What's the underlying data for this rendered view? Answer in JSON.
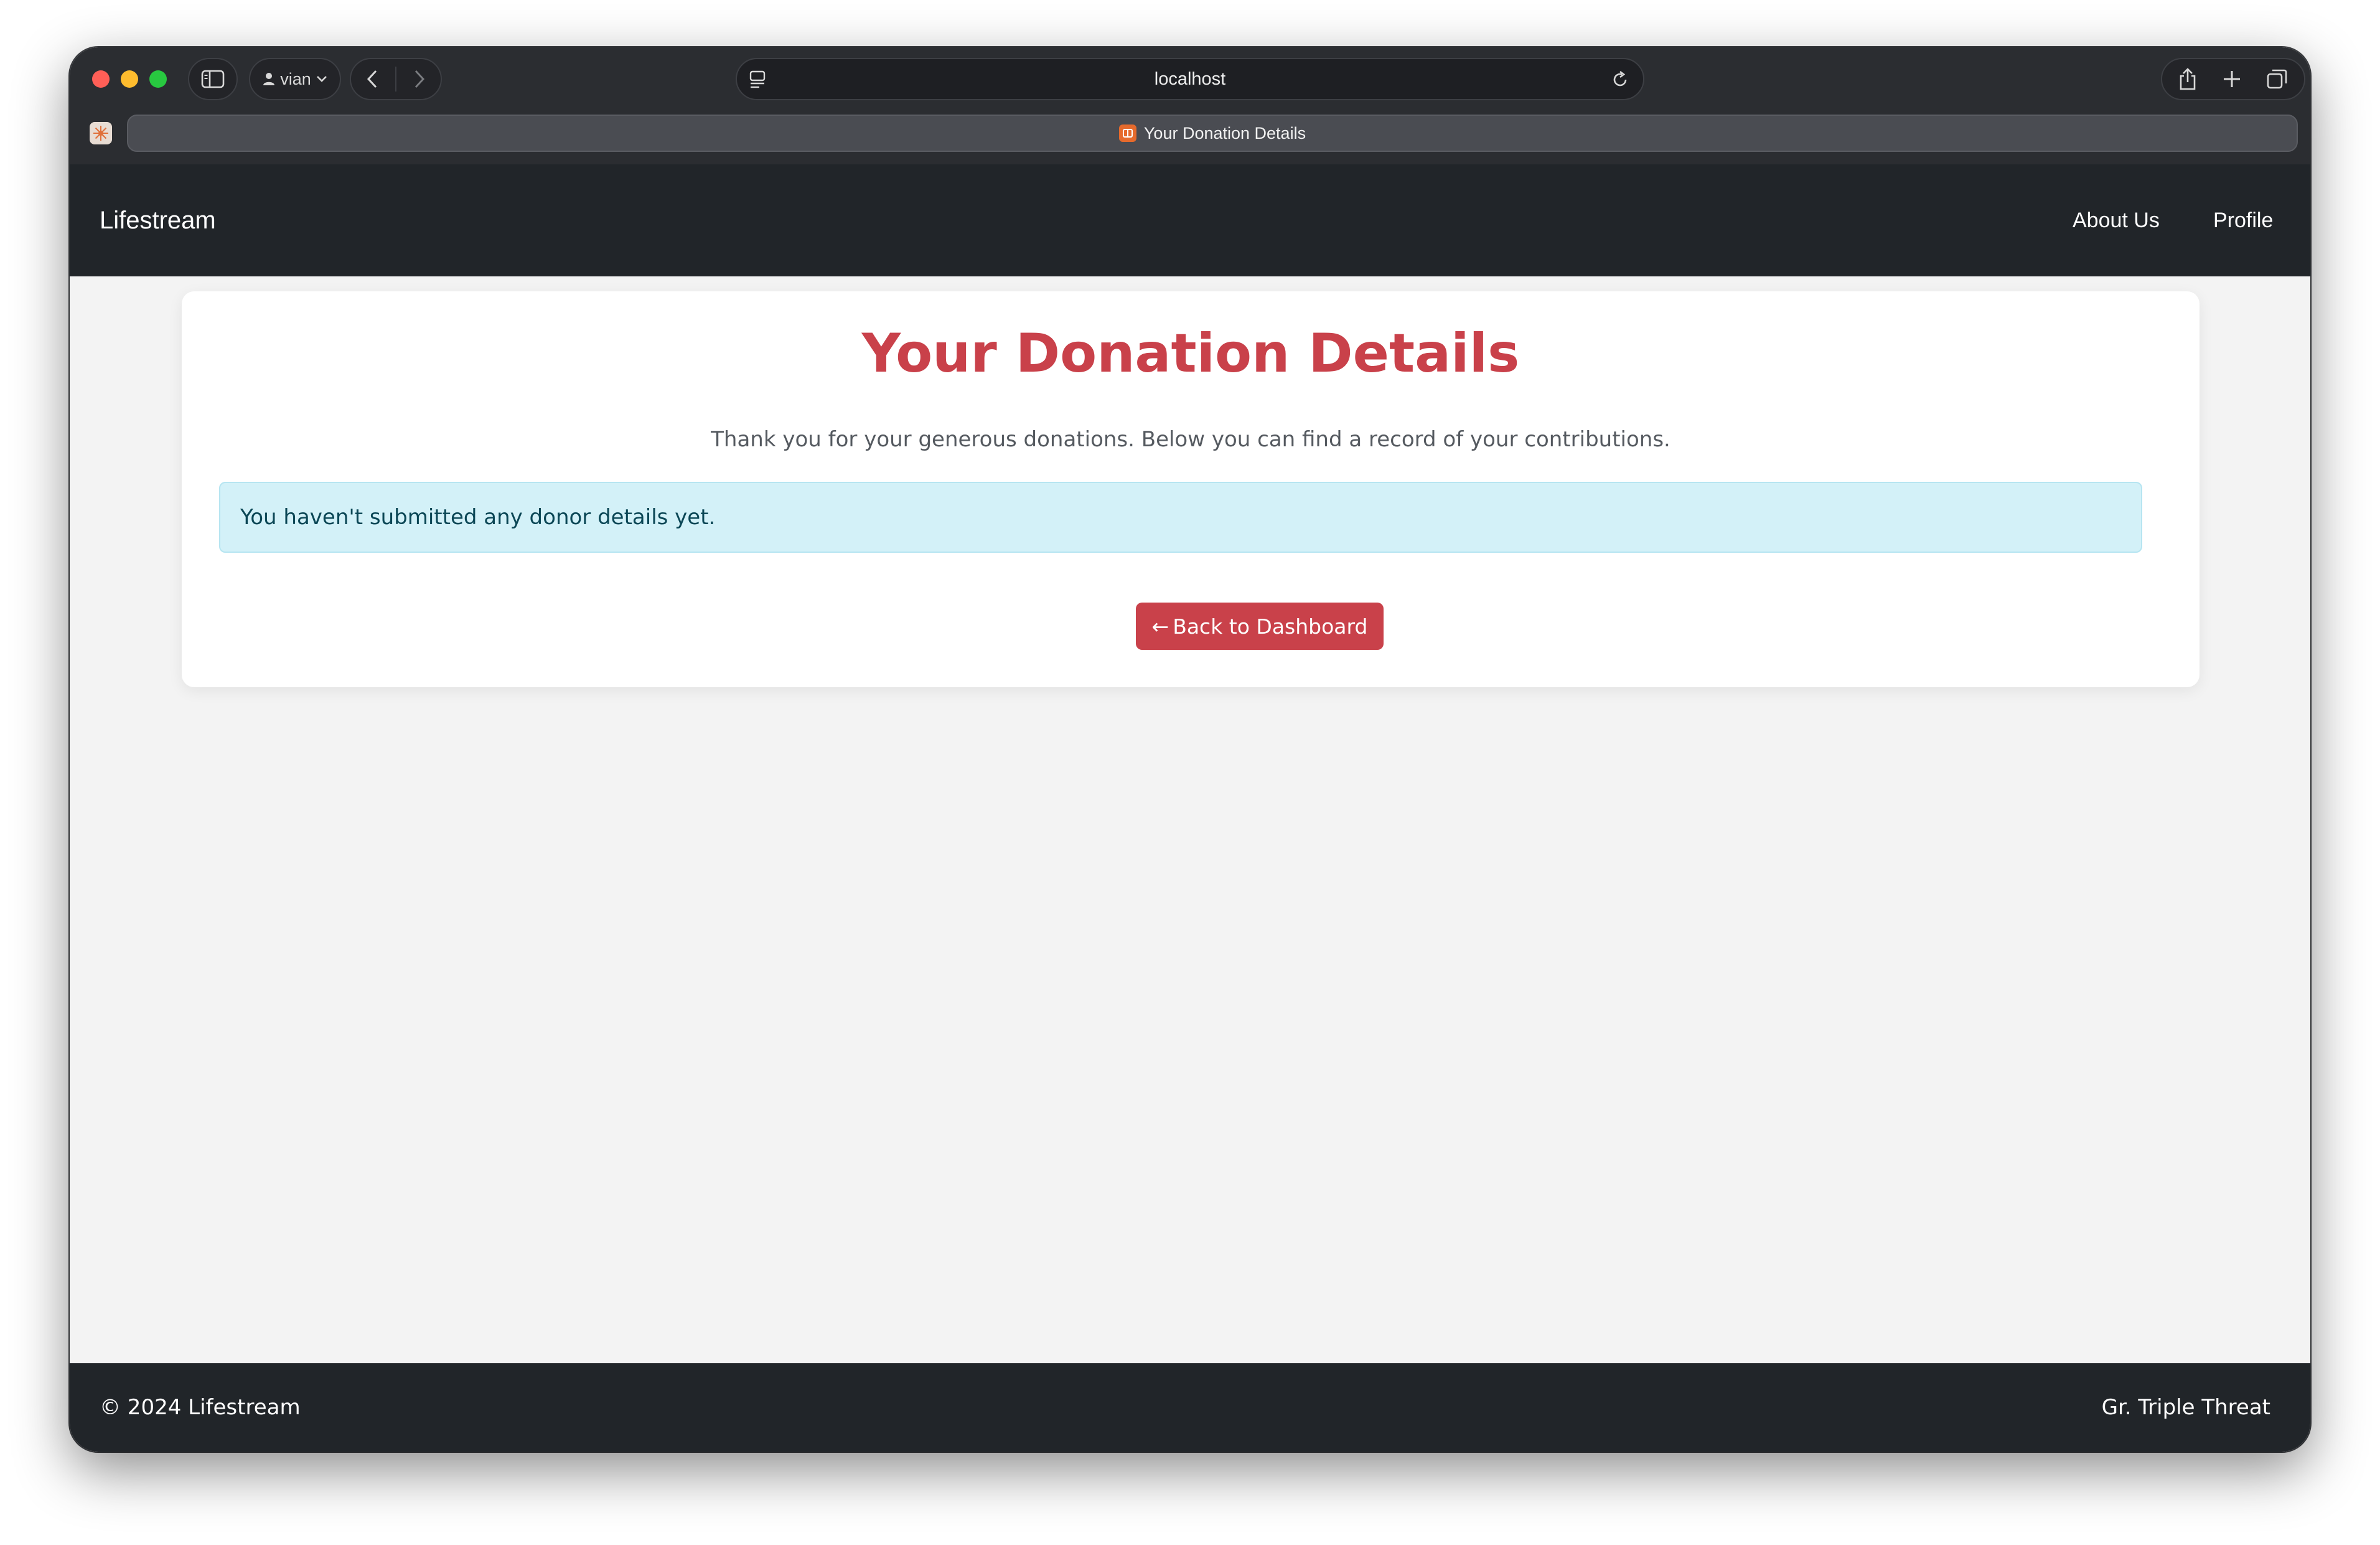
{
  "browser": {
    "profile_name": "vian",
    "address": "localhost",
    "tab_title": "Your Donation Details",
    "icons": {
      "sidebar": "sidebar-toggle-icon",
      "profile": "person-icon",
      "back": "chevron-left-icon",
      "forward": "chevron-right-icon",
      "site": "site-settings-icon",
      "reload": "reload-icon",
      "share": "share-icon",
      "new_tab": "plus-icon",
      "tab_overview": "tabs-overview-icon"
    }
  },
  "navbar": {
    "brand": "Lifestream",
    "links": [
      {
        "label": "About Us"
      },
      {
        "label": "Profile"
      }
    ]
  },
  "main": {
    "title": "Your Donation Details",
    "intro": "Thank you for your generous donations. Below you can find a record of your contributions.",
    "alert": "You haven't submitted any donor details yet.",
    "back_button": {
      "arrow": "←",
      "label": "Back to Dashboard"
    }
  },
  "footer": {
    "copyright": "© 2024 Lifestream",
    "credit": "Gr. Triple Threat"
  },
  "colors": {
    "accent": "#c9414a",
    "dark": "#212529",
    "alert_bg": "#d3f1f8",
    "page_bg": "#f3f3f3"
  }
}
